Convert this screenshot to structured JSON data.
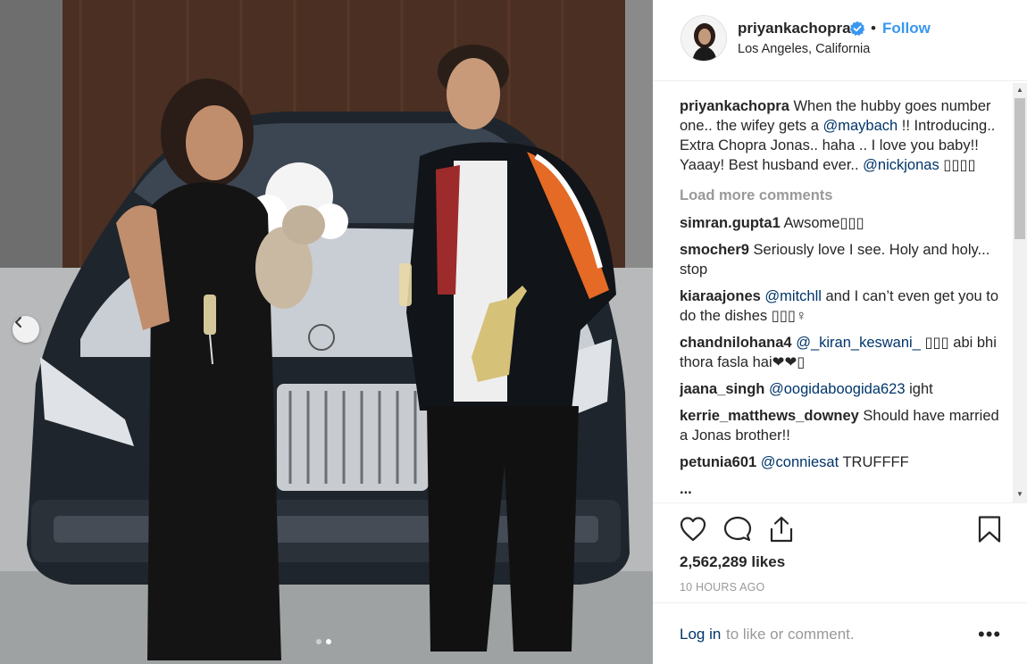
{
  "post": {
    "username": "priyankachopra",
    "bullet": "•",
    "follow_label": "Follow",
    "location": "Los Angeles, California",
    "caption": {
      "user": "priyankachopra",
      "text_1": " When the hubby goes number one.. the wifey gets a ",
      "mention_1": "@maybach",
      "text_2": " !! Introducing.. Extra Chopra Jonas.. haha .. I love you baby!! Yaaay! Best husband ever.. ",
      "mention_2": "@nickjonas",
      "text_3": " ▯▯▯▯"
    },
    "load_more_label": "Load more comments",
    "comments": [
      {
        "user": "simran.gupta1",
        "parts": [
          {
            "t": " Awsome▯▯▯",
            "m": false
          }
        ]
      },
      {
        "user": "smocher9",
        "parts": [
          {
            "t": " Seriously love I see. Holy and holy... stop",
            "m": false
          }
        ]
      },
      {
        "user": "kiaraajones",
        "parts": [
          {
            "t": " ",
            "m": false
          },
          {
            "t": "@mitchll",
            "m": true
          },
          {
            "t": " and I can’t even get you to do the dishes ▯▯▯♀",
            "m": false
          }
        ]
      },
      {
        "user": "chandnilohana4",
        "parts": [
          {
            "t": " ",
            "m": false
          },
          {
            "t": "@_kiran_keswani_",
            "m": true
          },
          {
            "t": " ▯▯▯ abi bhi thora fasla hai❤❤▯",
            "m": false
          }
        ]
      },
      {
        "user": "jaana_singh",
        "parts": [
          {
            "t": " ",
            "m": false
          },
          {
            "t": "@oogidaboogida623",
            "m": true
          },
          {
            "t": " ight",
            "m": false
          }
        ]
      },
      {
        "user": "kerrie_matthews_downey",
        "parts": [
          {
            "t": " Should have married a Jonas brother!!",
            "m": false
          }
        ]
      },
      {
        "user": "petunia601",
        "parts": [
          {
            "t": " ",
            "m": false
          },
          {
            "t": "@conniesat",
            "m": true
          },
          {
            "t": " TRUFFFF",
            "m": false
          }
        ]
      },
      {
        "user": "...",
        "parts": [
          {
            "t": "",
            "m": false
          }
        ]
      }
    ],
    "likes": "2,562,289 likes",
    "timestamp": "10 HOURS AGO",
    "login_link": "Log in",
    "login_text": " to like or comment.",
    "more_label": "•••",
    "carousel": {
      "total": 2,
      "active": 2
    }
  },
  "icons": {
    "verified": "verified-badge-icon",
    "like": "heart-icon",
    "comment": "comment-bubble-icon",
    "share": "share-upload-icon",
    "save": "bookmark-icon",
    "prev": "chevron-left-icon"
  },
  "colors": {
    "accent": "#3897f0",
    "link": "#003569",
    "muted": "#999999",
    "text": "#262626"
  }
}
